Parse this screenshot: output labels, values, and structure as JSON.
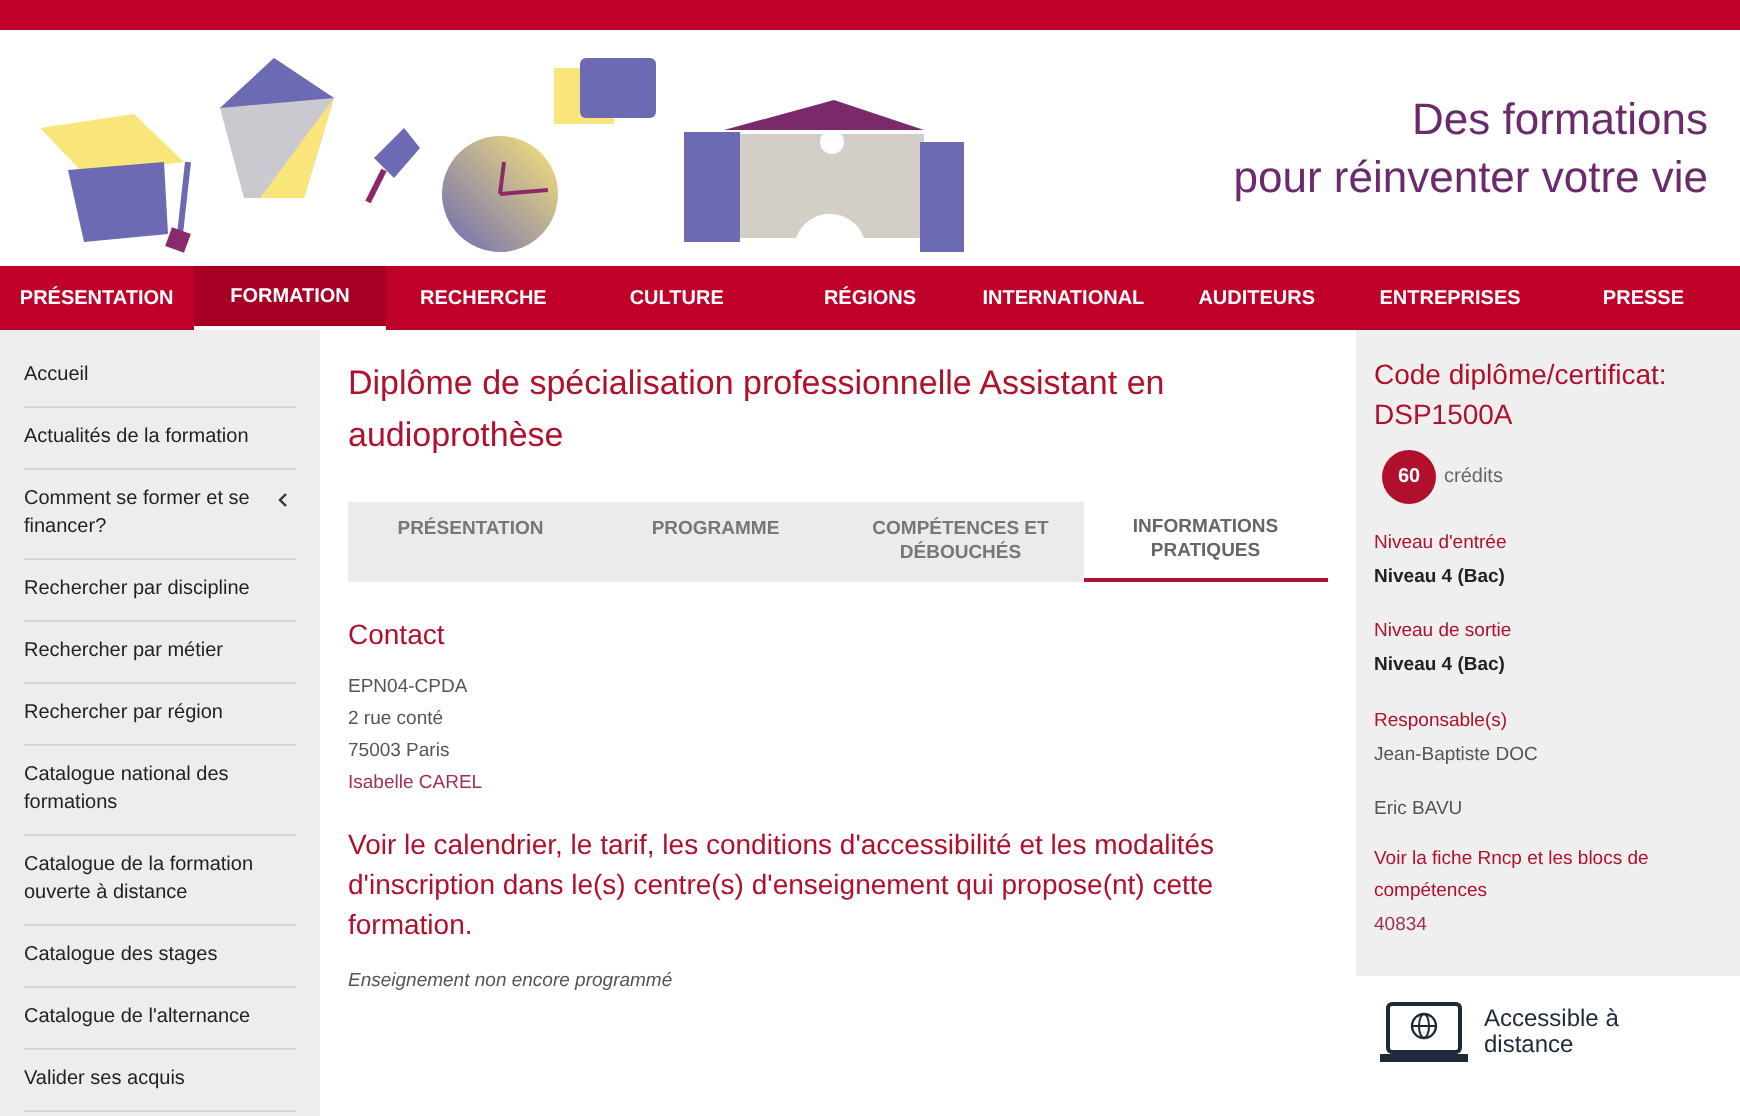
{
  "banner": {
    "tagline_lines": [
      "Des formations",
      "pour réinventer votre vie"
    ]
  },
  "nav": [
    {
      "label": "PRÉSENTATION",
      "selected": false
    },
    {
      "label": "FORMATION",
      "selected": true
    },
    {
      "label": "RECHERCHE",
      "selected": false
    },
    {
      "label": "CULTURE",
      "selected": false
    },
    {
      "label": "RÉGIONS",
      "selected": false
    },
    {
      "label": "INTERNATIONAL",
      "selected": false
    },
    {
      "label": "AUDITEURS",
      "selected": false
    },
    {
      "label": "ENTREPRISES",
      "selected": false
    },
    {
      "label": "PRESSE",
      "selected": false
    }
  ],
  "sidebar": {
    "items": [
      {
        "label": "Accueil",
        "submenu": false
      },
      {
        "label": "Actualités de la formation",
        "submenu": false
      },
      {
        "label": "Comment se former et se financer?",
        "submenu": true
      },
      {
        "label": "Rechercher par discipline",
        "submenu": false
      },
      {
        "label": "Rechercher par métier",
        "submenu": false
      },
      {
        "label": "Rechercher par région",
        "submenu": false
      },
      {
        "label": "Catalogue national des formations",
        "submenu": false
      },
      {
        "label": "Catalogue de la formation ouverte à distance",
        "submenu": false
      },
      {
        "label": "Catalogue des stages",
        "submenu": false
      },
      {
        "label": "Catalogue de l'alternance",
        "submenu": false
      },
      {
        "label": "Valider ses acquis",
        "submenu": false
      }
    ]
  },
  "main": {
    "title": "Diplôme de spécialisation professionnelle Assistant en audioprothèse",
    "tabs": [
      {
        "label": "PRÉSENTATION",
        "selected": false
      },
      {
        "label": "PROGRAMME",
        "selected": false
      },
      {
        "label": "COMPÉTENCES ET DÉBOUCHÉS",
        "selected": false
      },
      {
        "label": "INFORMATIONS PRATIQUES",
        "selected": true
      }
    ],
    "contact_heading": "Contact",
    "address_lines": [
      "EPN04-CPDA",
      "2 rue conté",
      "75003 Paris"
    ],
    "contact_name": "Isabelle CAREL",
    "calendar_link": "Voir le calendrier, le tarif, les conditions d'accessibilité et les modalités d'inscription dans le(s) centre(s) d'enseignement qui propose(nt) cette formation.",
    "note": "Enseignement non encore programmé"
  },
  "aside": {
    "code_label": "Code diplôme/certificat:",
    "code": "DSP1500A",
    "credits_value": "60",
    "credits_label": "crédits",
    "fields": [
      {
        "label": "Niveau d'entrée",
        "kind": "bold",
        "values": [
          "Niveau 4 (Bac)"
        ]
      },
      {
        "label": "Niveau de sortie",
        "kind": "bold",
        "values": [
          "Niveau 4 (Bac)"
        ]
      },
      {
        "label": "Responsable(s)",
        "kind": "plain",
        "values": [
          "Jean-Baptiste DOC",
          "Eric BAVU"
        ]
      }
    ],
    "rncp_link": "Voir la fiche Rncp et les blocs de compétences",
    "rncp_number": "40834",
    "distance_badge": "Accessible à distance"
  }
}
